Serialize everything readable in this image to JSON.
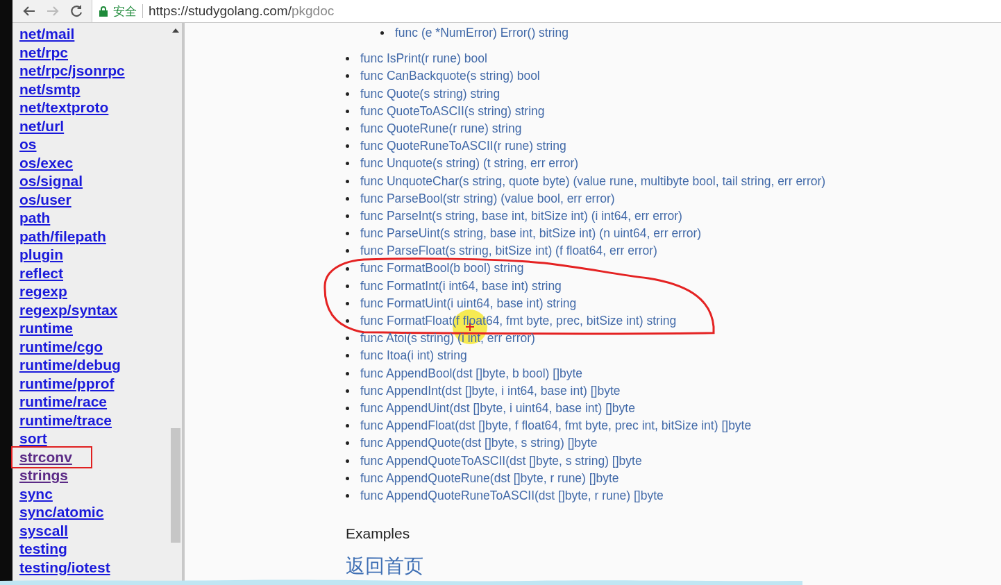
{
  "browser": {
    "secure_label": "安全",
    "url_host": "https://studygolang.com/",
    "url_path": "pkgdoc"
  },
  "sidebar": {
    "items": [
      {
        "label": "net/mail",
        "visited": false,
        "marked": false
      },
      {
        "label": "net/rpc",
        "visited": false,
        "marked": false
      },
      {
        "label": "net/rpc/jsonrpc",
        "visited": false,
        "marked": false
      },
      {
        "label": "net/smtp",
        "visited": false,
        "marked": false
      },
      {
        "label": "net/textproto",
        "visited": false,
        "marked": false
      },
      {
        "label": "net/url",
        "visited": false,
        "marked": false
      },
      {
        "label": "os",
        "visited": false,
        "marked": false
      },
      {
        "label": "os/exec",
        "visited": false,
        "marked": false
      },
      {
        "label": "os/signal",
        "visited": false,
        "marked": false
      },
      {
        "label": "os/user",
        "visited": false,
        "marked": false
      },
      {
        "label": "path",
        "visited": false,
        "marked": false
      },
      {
        "label": "path/filepath",
        "visited": false,
        "marked": false
      },
      {
        "label": "plugin",
        "visited": false,
        "marked": false
      },
      {
        "label": "reflect",
        "visited": false,
        "marked": false
      },
      {
        "label": "regexp",
        "visited": false,
        "marked": false
      },
      {
        "label": "regexp/syntax",
        "visited": false,
        "marked": false
      },
      {
        "label": "runtime",
        "visited": false,
        "marked": false
      },
      {
        "label": "runtime/cgo",
        "visited": false,
        "marked": false
      },
      {
        "label": "runtime/debug",
        "visited": false,
        "marked": false
      },
      {
        "label": "runtime/pprof",
        "visited": false,
        "marked": false
      },
      {
        "label": "runtime/race",
        "visited": false,
        "marked": false
      },
      {
        "label": "runtime/trace",
        "visited": false,
        "marked": false
      },
      {
        "label": "sort",
        "visited": false,
        "marked": false
      },
      {
        "label": "strconv",
        "visited": true,
        "marked": true
      },
      {
        "label": "strings",
        "visited": true,
        "marked": false
      },
      {
        "label": "sync",
        "visited": false,
        "marked": false
      },
      {
        "label": "sync/atomic",
        "visited": false,
        "marked": false
      },
      {
        "label": "syscall",
        "visited": false,
        "marked": false
      },
      {
        "label": "testing",
        "visited": false,
        "marked": false
      },
      {
        "label": "testing/iotest",
        "visited": false,
        "marked": false
      }
    ]
  },
  "content": {
    "nested_items": [
      "func (e *NumError) Error() string"
    ],
    "function_groups": [
      {
        "circled": false,
        "items": [
          "func IsPrint(r rune) bool",
          "func CanBackquote(s string) bool",
          "func Quote(s string) string",
          "func QuoteToASCII(s string) string",
          "func QuoteRune(r rune) string",
          "func QuoteRuneToASCII(r rune) string",
          "func Unquote(s string) (t string, err error)",
          "func UnquoteChar(s string, quote byte) (value rune, multibyte bool, tail string, err error)",
          "func ParseBool(str string) (value bool, err error)",
          "func ParseInt(s string, base int, bitSize int) (i int64, err error)",
          "func ParseUint(s string, base int, bitSize int) (n uint64, err error)",
          "func ParseFloat(s string, bitSize int) (f float64, err error)"
        ]
      },
      {
        "circled": true,
        "items": [
          "func FormatBool(b bool) string",
          "func FormatInt(i int64, base int) string",
          "func FormatUint(i uint64, base int) string",
          "func FormatFloat(f float64, fmt byte, prec, bitSize int) string"
        ]
      },
      {
        "circled": false,
        "items": [
          "func Atoi(s string) (i int, err error)",
          "func Itoa(i int) string",
          "func AppendBool(dst []byte, b bool) []byte",
          "func AppendInt(dst []byte, i int64, base int) []byte",
          "func AppendUint(dst []byte, i uint64, base int) []byte",
          "func AppendFloat(dst []byte, f float64, fmt byte, prec int, bitSize int) []byte",
          "func AppendQuote(dst []byte, s string) []byte",
          "func AppendQuoteToASCII(dst []byte, s string) []byte",
          "func AppendQuoteRune(dst []byte, r rune) []byte",
          "func AppendQuoteRuneToASCII(dst []byte, r rune) []byte"
        ]
      }
    ],
    "examples_heading": "Examples",
    "home_link": "返回首页"
  }
}
